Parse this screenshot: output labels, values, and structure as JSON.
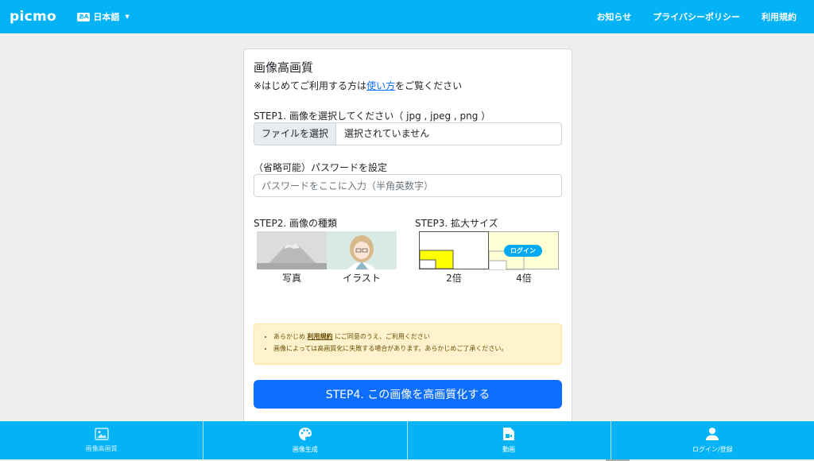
{
  "header": {
    "brand": "picmo",
    "language": "日本語",
    "language_icon": "あA",
    "nav": [
      "お知らせ",
      "プライバシーポリシー",
      "利用規約"
    ]
  },
  "form": {
    "title": "画像高画質",
    "note_prefix": "※はじめてご利用する方は",
    "note_link": "使い方",
    "note_suffix": "をご覧ください",
    "step1_label": "STEP1. 画像を選択してください（ jpg , jpeg , png ）",
    "file_button": "ファイルを選択",
    "file_status": "選択されていません",
    "password_label": "（省略可能）パスワードを設定",
    "password_placeholder": "パスワードをここに入力（半角英数字）",
    "step2_label": "STEP2. 画像の種類",
    "step2_options": [
      "写真",
      "イラスト"
    ],
    "step3_label": "STEP3. 拡大サイズ",
    "step3_options": [
      "2倍",
      "4倍"
    ],
    "login_badge": "ログイン",
    "terms_prefix": "あらかじめ",
    "terms_link": "利用規約",
    "terms_suffix": "にご同意のうえ、ご利用ください",
    "terms_note": "画像によっては高画質化に失敗する場合があります。あらかじめご了承ください。",
    "submit": "STEP4. この画像を高画質化する"
  },
  "bottom_nav": [
    {
      "label": "画像高画質",
      "icon": "image-icon"
    },
    {
      "label": "画像生成",
      "icon": "palette-icon"
    },
    {
      "label": "動画",
      "icon": "video-file-icon"
    },
    {
      "label": "ログイン/登録",
      "icon": "person-icon"
    }
  ],
  "colors": {
    "brand": "#03b3f5",
    "primary": "#0d6efd",
    "highlight": "#ffff00",
    "warning_bg": "#fff3cd"
  }
}
